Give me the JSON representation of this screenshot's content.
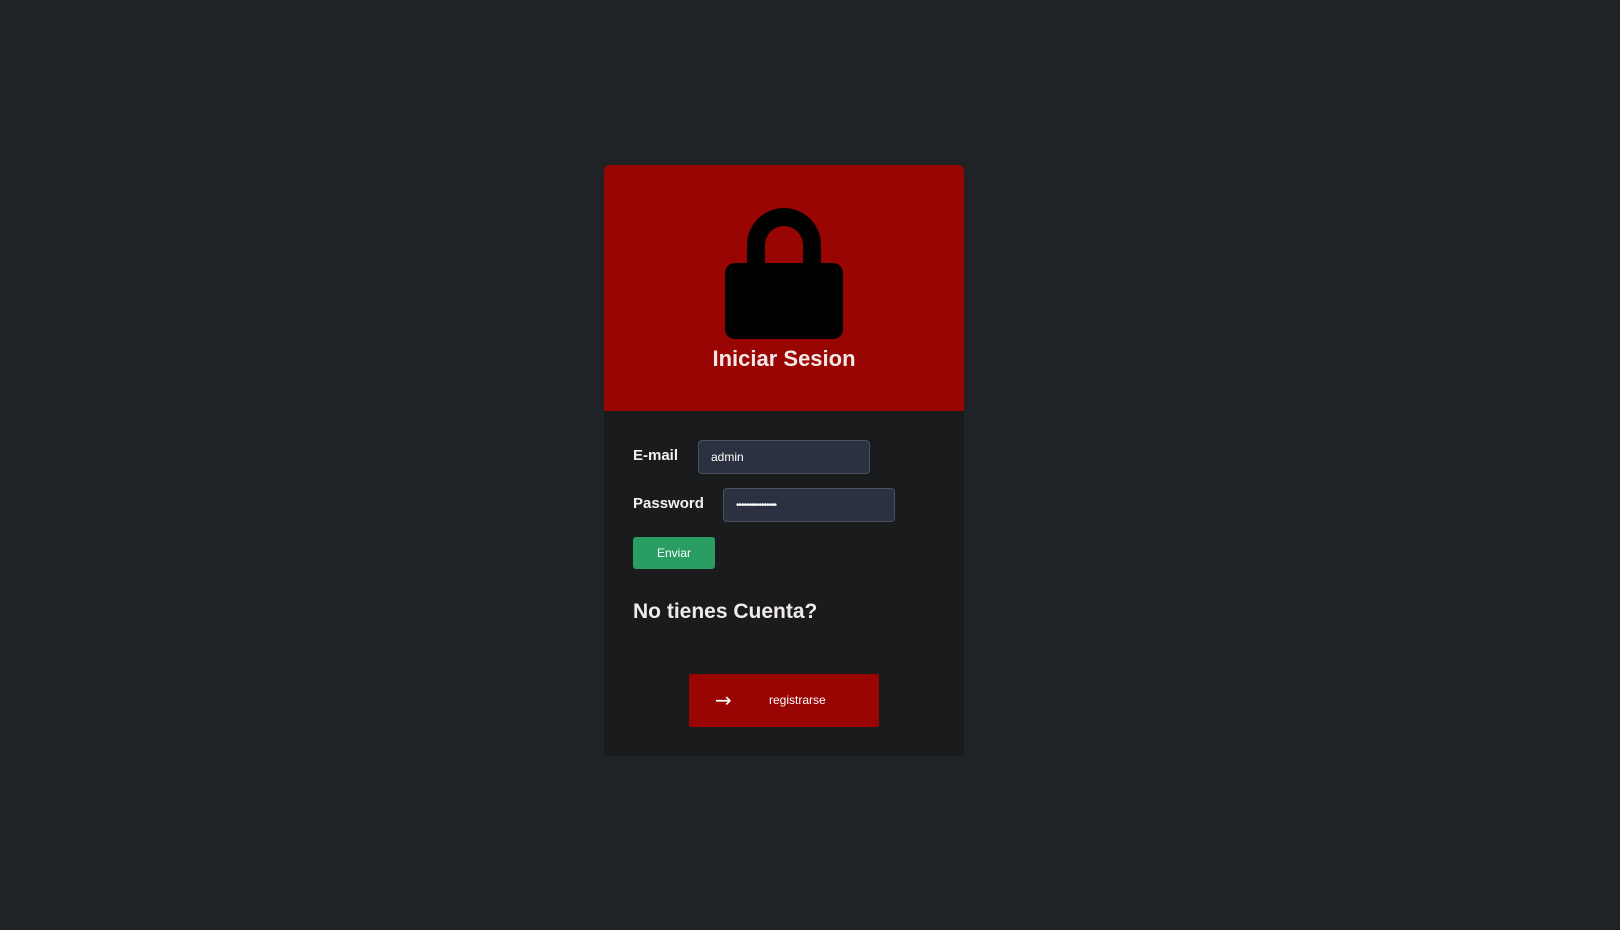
{
  "header": {
    "icon": "lock-icon",
    "title": "Iniciar Sesion"
  },
  "form": {
    "email_label": "E-mail",
    "email_value": "admin",
    "password_label": "Password",
    "password_value": "••••••••••••••••",
    "submit_label": "Enviar"
  },
  "signup": {
    "question": "No tienes Cuenta?",
    "arrow_icon": "arrow-right-icon",
    "button_label": "registrarse"
  },
  "colors": {
    "background": "#202326",
    "card": "#1a1b1d",
    "accent_red": "#990503",
    "submit_green": "#2a9d63",
    "input_bg": "#2b3140"
  }
}
